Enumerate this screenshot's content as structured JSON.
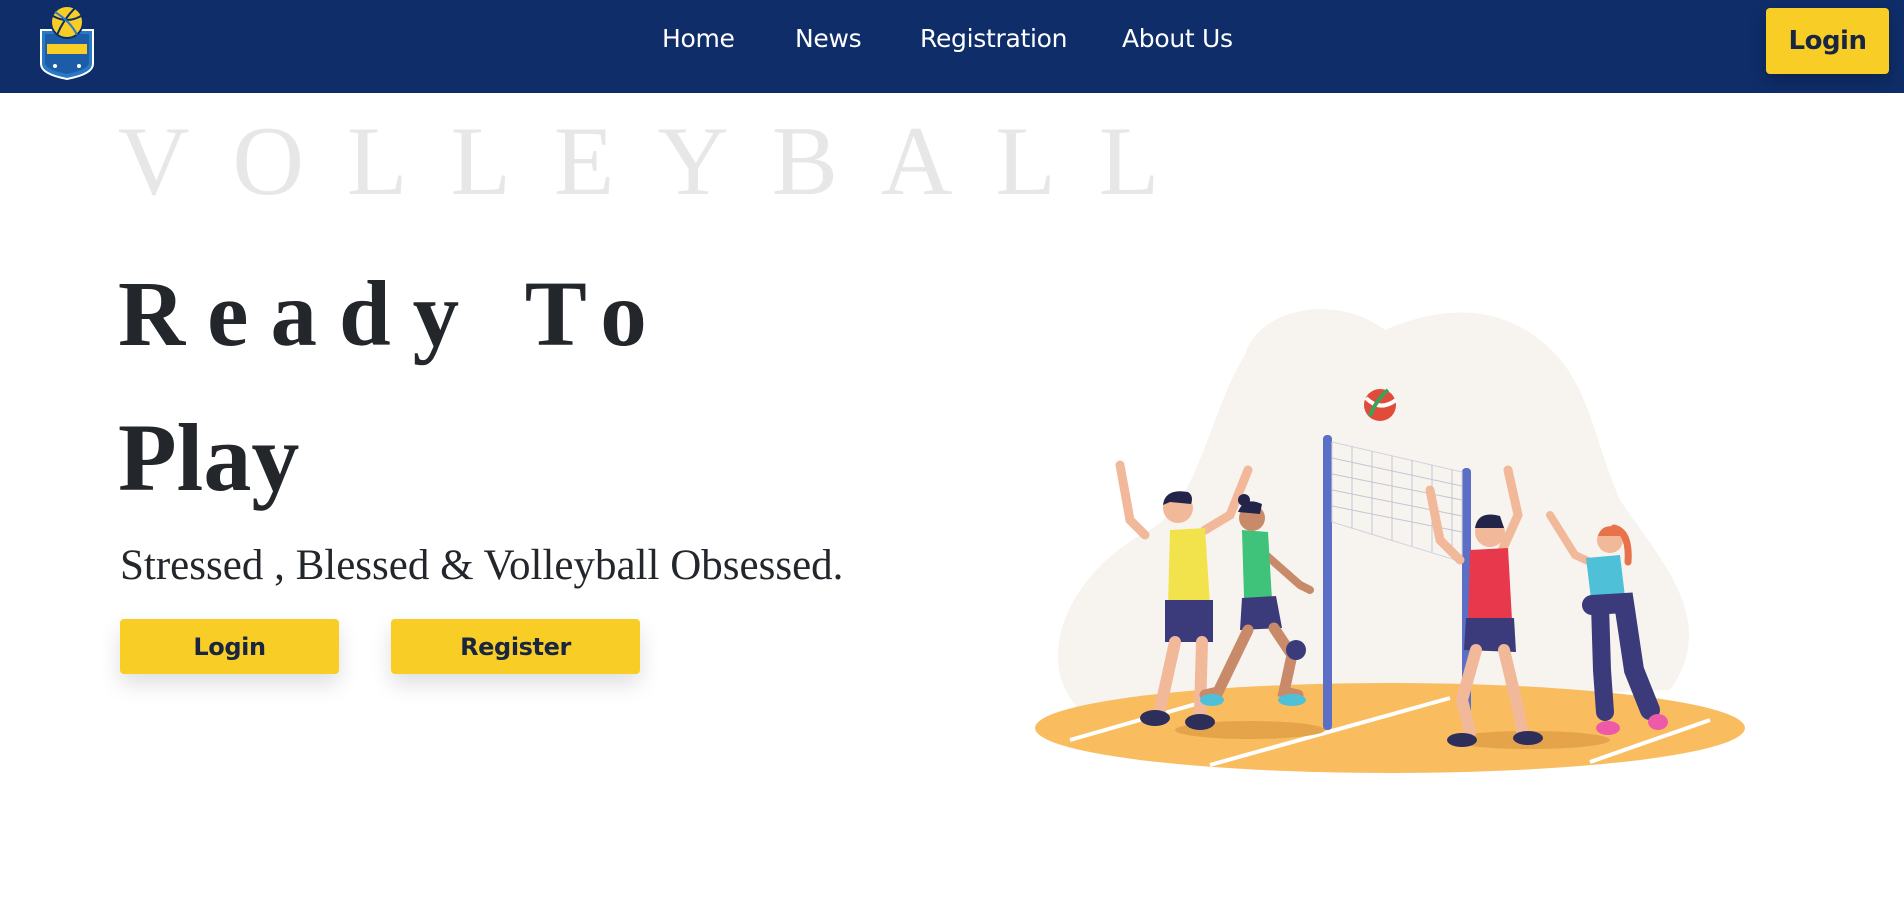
{
  "nav": {
    "links": [
      {
        "label": "Home"
      },
      {
        "label": "News"
      },
      {
        "label": "Registration"
      },
      {
        "label": "About Us"
      }
    ],
    "login_label": "Login",
    "logo_icon": "volleyball-league-shield-logo"
  },
  "hero": {
    "watermark": "VOLLEYBALL",
    "heading_line1": "Ready To",
    "heading_line2": "Play",
    "tagline": "Stressed , Blessed & Volleyball Obsessed.",
    "login_label": "Login",
    "register_label": "Register",
    "illustration": "volleyball-players-illustration"
  },
  "colors": {
    "navbar": "#0f2d69",
    "accent": "#f8ce26",
    "text": "#23262b",
    "watermark": "#e7e7e7",
    "court": "#f9bd60"
  }
}
